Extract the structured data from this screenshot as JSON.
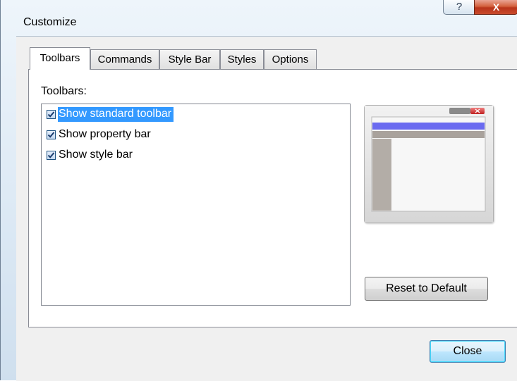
{
  "window": {
    "title": "Customize",
    "help_label": "?",
    "close_glyph": "X"
  },
  "tabs": [
    {
      "label": "Toolbars",
      "active": true
    },
    {
      "label": "Commands",
      "active": false
    },
    {
      "label": "Style Bar",
      "active": false
    },
    {
      "label": "Styles",
      "active": false
    },
    {
      "label": "Options",
      "active": false
    }
  ],
  "toolbars_panel": {
    "list_label": "Toolbars:",
    "items": [
      {
        "label": "Show standard toolbar",
        "checked": true,
        "selected": true
      },
      {
        "label": "Show property bar",
        "checked": true,
        "selected": false
      },
      {
        "label": "Show style bar",
        "checked": true,
        "selected": false
      }
    ],
    "reset_label": "Reset to Default"
  },
  "footer": {
    "close_label": "Close"
  },
  "colors": {
    "selection": "#3399ff",
    "preview_accent": "#6a6af0",
    "close_button_red": "#c94a2c"
  }
}
